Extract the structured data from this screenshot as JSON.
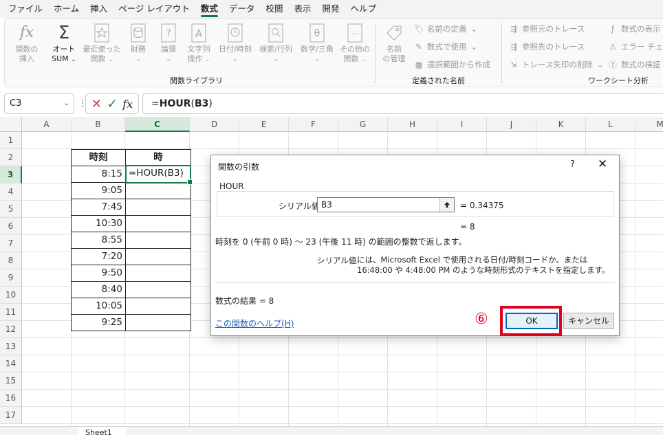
{
  "menu": {
    "items": [
      {
        "label": "ファイル",
        "active": false
      },
      {
        "label": "ホーム",
        "active": false
      },
      {
        "label": "挿入",
        "active": false
      },
      {
        "label": "ページ レイアウト",
        "active": false
      },
      {
        "label": "数式",
        "active": true
      },
      {
        "label": "データ",
        "active": false
      },
      {
        "label": "校閲",
        "active": false
      },
      {
        "label": "表示",
        "active": false
      },
      {
        "label": "開発",
        "active": false
      },
      {
        "label": "ヘルプ",
        "active": false
      }
    ]
  },
  "ribbon": {
    "insert_function": {
      "line1": "関数の",
      "line2": "挿入"
    },
    "autosum": {
      "line1": "オート",
      "line2": "SUM"
    },
    "recent": {
      "line1": "最近使った",
      "line2": "関数"
    },
    "financial": {
      "line1": "財務"
    },
    "logical": {
      "line1": "論理"
    },
    "text": {
      "line1": "文字列",
      "line2": "操作"
    },
    "datetime": {
      "line1": "日付/時刻"
    },
    "lookup": {
      "line1": "検索/行列"
    },
    "math": {
      "line1": "数学/三角"
    },
    "more": {
      "line1": "その他の",
      "line2": "関数"
    },
    "group_function_library": "関数ライブラリ",
    "name_manager": {
      "line1": "名前",
      "line2": "の管理"
    },
    "define_name": "名前の定義",
    "use_in_formula": "数式で使用",
    "create_from_selection": "選択範囲から作成",
    "group_defined_names": "定義された名前",
    "trace_precedents": "参照元のトレース",
    "trace_dependents": "参照先のトレース",
    "remove_arrows": "トレース矢印の削除",
    "show_formulas": "数式の表示",
    "error_checking": "エラー チェック",
    "evaluate_formula": "数式の検証",
    "group_formula_auditing": "ワークシート分析"
  },
  "formula_bar": {
    "name_box": "C3",
    "formula_prefix": "=",
    "formula_bold": "HOUR",
    "formula_open": "(",
    "formula_ref": "B3",
    "formula_close": ")"
  },
  "grid": {
    "columns": [
      "A",
      "B",
      "C",
      "D",
      "E",
      "F",
      "G",
      "H",
      "I",
      "J",
      "K",
      "L",
      "M"
    ],
    "rows": [
      "1",
      "2",
      "3",
      "4",
      "5",
      "6",
      "7",
      "8",
      "9",
      "10",
      "11",
      "12",
      "13",
      "14",
      "15",
      "16",
      "17"
    ],
    "selected_column": "C",
    "selected_row": "3"
  },
  "table": {
    "header_time": "時刻",
    "header_hour": "時",
    "times": [
      "8:15",
      "9:05",
      "7:45",
      "10:30",
      "8:55",
      "7:20",
      "9:50",
      "8:40",
      "10:05",
      "9:25"
    ],
    "editing_formula": "=HOUR(B3)"
  },
  "sheet_tab": "Sheet1",
  "dialog": {
    "title": "関数の引数",
    "help": "?",
    "close": "✕",
    "function_name": "HOUR",
    "arg_label": "シリアル値",
    "arg_value": "B3",
    "arg_eval": "=  0.34375",
    "result_eval": "=  8",
    "description": "時刻を 0 (午前 0 時) ～ 23 (午後 11 時) の範囲の整数で返します。",
    "arg_desc_label": "シリアル値",
    "arg_desc": "には、Microsoft Excel で使用される日付/時刻コードか、または 16:48:00 や 4:48:00 PM のような時刻形式のテキストを指定します。",
    "formula_result": "数式の結果 =   8",
    "help_link": "この関数のヘルプ(H)",
    "ok": "OK",
    "cancel": "キャンセル"
  },
  "annotation": {
    "number": "⑥",
    "color": "#e00020"
  },
  "colors": {
    "excel_green": "#107c41",
    "link_blue": "#1a5fb4",
    "ok_border": "#0067c0"
  }
}
